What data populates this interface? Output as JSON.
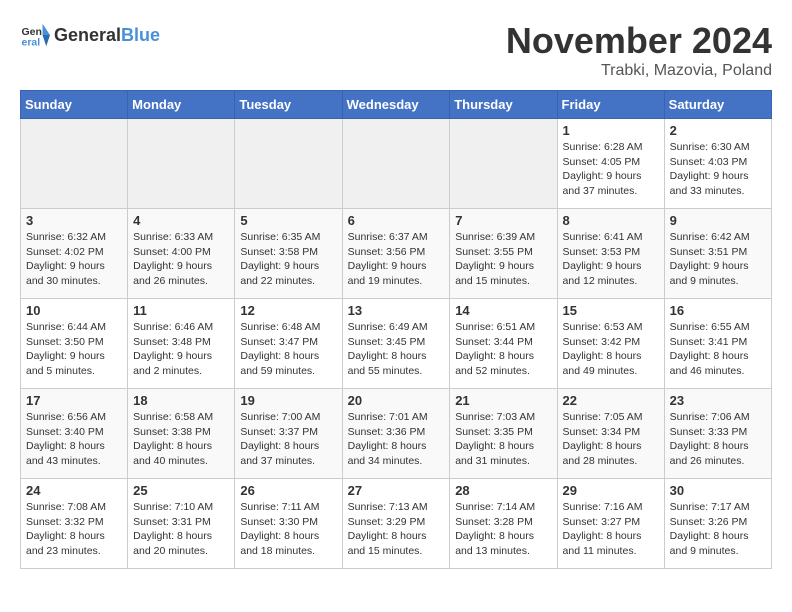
{
  "header": {
    "logo": {
      "general": "General",
      "blue": "Blue"
    },
    "title": "November 2024",
    "location": "Trabki, Mazovia, Poland"
  },
  "calendar": {
    "days_of_week": [
      "Sunday",
      "Monday",
      "Tuesday",
      "Wednesday",
      "Thursday",
      "Friday",
      "Saturday"
    ],
    "weeks": [
      [
        {
          "day": "",
          "empty": true
        },
        {
          "day": "",
          "empty": true
        },
        {
          "day": "",
          "empty": true
        },
        {
          "day": "",
          "empty": true
        },
        {
          "day": "",
          "empty": true
        },
        {
          "day": "1",
          "sunrise": "Sunrise: 6:28 AM",
          "sunset": "Sunset: 4:05 PM",
          "daylight": "Daylight: 9 hours and 37 minutes."
        },
        {
          "day": "2",
          "sunrise": "Sunrise: 6:30 AM",
          "sunset": "Sunset: 4:03 PM",
          "daylight": "Daylight: 9 hours and 33 minutes."
        }
      ],
      [
        {
          "day": "3",
          "sunrise": "Sunrise: 6:32 AM",
          "sunset": "Sunset: 4:02 PM",
          "daylight": "Daylight: 9 hours and 30 minutes."
        },
        {
          "day": "4",
          "sunrise": "Sunrise: 6:33 AM",
          "sunset": "Sunset: 4:00 PM",
          "daylight": "Daylight: 9 hours and 26 minutes."
        },
        {
          "day": "5",
          "sunrise": "Sunrise: 6:35 AM",
          "sunset": "Sunset: 3:58 PM",
          "daylight": "Daylight: 9 hours and 22 minutes."
        },
        {
          "day": "6",
          "sunrise": "Sunrise: 6:37 AM",
          "sunset": "Sunset: 3:56 PM",
          "daylight": "Daylight: 9 hours and 19 minutes."
        },
        {
          "day": "7",
          "sunrise": "Sunrise: 6:39 AM",
          "sunset": "Sunset: 3:55 PM",
          "daylight": "Daylight: 9 hours and 15 minutes."
        },
        {
          "day": "8",
          "sunrise": "Sunrise: 6:41 AM",
          "sunset": "Sunset: 3:53 PM",
          "daylight": "Daylight: 9 hours and 12 minutes."
        },
        {
          "day": "9",
          "sunrise": "Sunrise: 6:42 AM",
          "sunset": "Sunset: 3:51 PM",
          "daylight": "Daylight: 9 hours and 9 minutes."
        }
      ],
      [
        {
          "day": "10",
          "sunrise": "Sunrise: 6:44 AM",
          "sunset": "Sunset: 3:50 PM",
          "daylight": "Daylight: 9 hours and 5 minutes."
        },
        {
          "day": "11",
          "sunrise": "Sunrise: 6:46 AM",
          "sunset": "Sunset: 3:48 PM",
          "daylight": "Daylight: 9 hours and 2 minutes."
        },
        {
          "day": "12",
          "sunrise": "Sunrise: 6:48 AM",
          "sunset": "Sunset: 3:47 PM",
          "daylight": "Daylight: 8 hours and 59 minutes."
        },
        {
          "day": "13",
          "sunrise": "Sunrise: 6:49 AM",
          "sunset": "Sunset: 3:45 PM",
          "daylight": "Daylight: 8 hours and 55 minutes."
        },
        {
          "day": "14",
          "sunrise": "Sunrise: 6:51 AM",
          "sunset": "Sunset: 3:44 PM",
          "daylight": "Daylight: 8 hours and 52 minutes."
        },
        {
          "day": "15",
          "sunrise": "Sunrise: 6:53 AM",
          "sunset": "Sunset: 3:42 PM",
          "daylight": "Daylight: 8 hours and 49 minutes."
        },
        {
          "day": "16",
          "sunrise": "Sunrise: 6:55 AM",
          "sunset": "Sunset: 3:41 PM",
          "daylight": "Daylight: 8 hours and 46 minutes."
        }
      ],
      [
        {
          "day": "17",
          "sunrise": "Sunrise: 6:56 AM",
          "sunset": "Sunset: 3:40 PM",
          "daylight": "Daylight: 8 hours and 43 minutes."
        },
        {
          "day": "18",
          "sunrise": "Sunrise: 6:58 AM",
          "sunset": "Sunset: 3:38 PM",
          "daylight": "Daylight: 8 hours and 40 minutes."
        },
        {
          "day": "19",
          "sunrise": "Sunrise: 7:00 AM",
          "sunset": "Sunset: 3:37 PM",
          "daylight": "Daylight: 8 hours and 37 minutes."
        },
        {
          "day": "20",
          "sunrise": "Sunrise: 7:01 AM",
          "sunset": "Sunset: 3:36 PM",
          "daylight": "Daylight: 8 hours and 34 minutes."
        },
        {
          "day": "21",
          "sunrise": "Sunrise: 7:03 AM",
          "sunset": "Sunset: 3:35 PM",
          "daylight": "Daylight: 8 hours and 31 minutes."
        },
        {
          "day": "22",
          "sunrise": "Sunrise: 7:05 AM",
          "sunset": "Sunset: 3:34 PM",
          "daylight": "Daylight: 8 hours and 28 minutes."
        },
        {
          "day": "23",
          "sunrise": "Sunrise: 7:06 AM",
          "sunset": "Sunset: 3:33 PM",
          "daylight": "Daylight: 8 hours and 26 minutes."
        }
      ],
      [
        {
          "day": "24",
          "sunrise": "Sunrise: 7:08 AM",
          "sunset": "Sunset: 3:32 PM",
          "daylight": "Daylight: 8 hours and 23 minutes."
        },
        {
          "day": "25",
          "sunrise": "Sunrise: 7:10 AM",
          "sunset": "Sunset: 3:31 PM",
          "daylight": "Daylight: 8 hours and 20 minutes."
        },
        {
          "day": "26",
          "sunrise": "Sunrise: 7:11 AM",
          "sunset": "Sunset: 3:30 PM",
          "daylight": "Daylight: 8 hours and 18 minutes."
        },
        {
          "day": "27",
          "sunrise": "Sunrise: 7:13 AM",
          "sunset": "Sunset: 3:29 PM",
          "daylight": "Daylight: 8 hours and 15 minutes."
        },
        {
          "day": "28",
          "sunrise": "Sunrise: 7:14 AM",
          "sunset": "Sunset: 3:28 PM",
          "daylight": "Daylight: 8 hours and 13 minutes."
        },
        {
          "day": "29",
          "sunrise": "Sunrise: 7:16 AM",
          "sunset": "Sunset: 3:27 PM",
          "daylight": "Daylight: 8 hours and 11 minutes."
        },
        {
          "day": "30",
          "sunrise": "Sunrise: 7:17 AM",
          "sunset": "Sunset: 3:26 PM",
          "daylight": "Daylight: 8 hours and 9 minutes."
        }
      ]
    ]
  }
}
